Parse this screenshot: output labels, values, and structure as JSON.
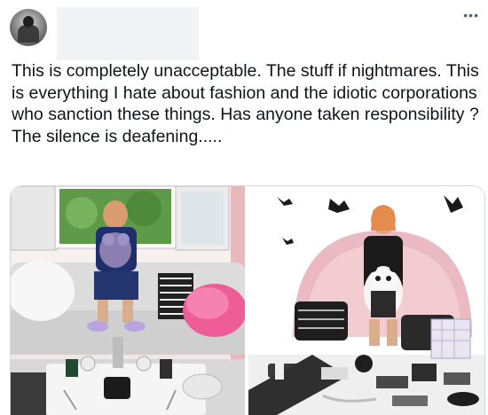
{
  "tweet": {
    "more_icon": "more-horizontal-icon",
    "text": "This is completely unacceptable. The stuff if nightmares. This is everything I hate about fashion and the idiotic corporations who sanction these things. Has anyone taken responsibility ? The silence is deafening....."
  },
  "media": {
    "images": [
      {
        "name": "left-photo"
      },
      {
        "name": "right-photo"
      }
    ]
  }
}
